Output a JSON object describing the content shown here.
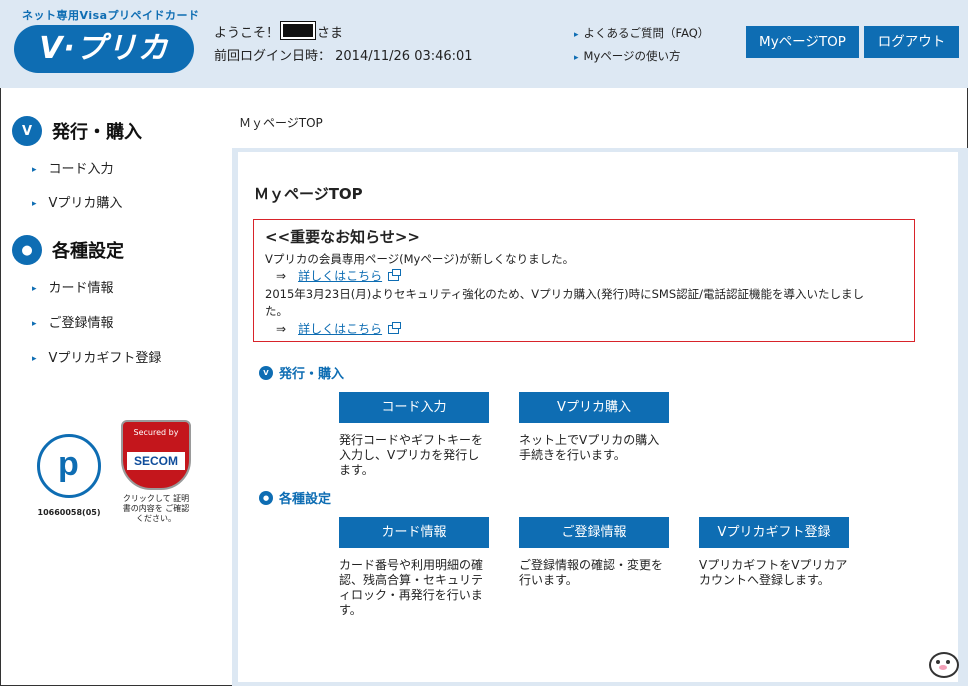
{
  "header": {
    "brand_tag": "ネット専用Visaプリペイドカード",
    "logo": "V·プリカ",
    "welcome_prefix": "ようこそ！",
    "welcome_suffix": "さま",
    "last_login": "前回ログイン日時： 2014/11/26 03:46:01",
    "links": [
      "よくあるご質問（FAQ）",
      "Myページの使い方"
    ],
    "mypage_button": "MyページTOP",
    "logout_button": "ログアウト"
  },
  "sidebar": {
    "section1_title": "発行・購入",
    "section1_items": [
      "コード入力",
      "Vプリカ購入"
    ],
    "section2_title": "各種設定",
    "section2_items": [
      "カード情報",
      "ご登録情報",
      "Vプリカギフト登録"
    ],
    "privacy_number": "10660058(05)",
    "secom_top": "Secured by",
    "secom_logo": "SECOM",
    "secom_caption": "クリックして 証明書の内容を ご確認ください。"
  },
  "breadcrumb": "ＭｙページTOP",
  "main": {
    "title": "ＭｙページTOP",
    "notice": {
      "title": "<<重要なお知らせ>>",
      "line1": "Vプリカの会員専用ページ(Myページ)が新しくなりました。",
      "more1": "詳しくはこちら",
      "line2": "2015年3月23日(月)よりセキュリティ強化のため、Vプリカ購入(発行)時にSMS認証/電話認証機能を導入いたしまし",
      "line2b": "た。",
      "more2": "詳しくはこちら",
      "arrow": "⇒"
    },
    "section1": {
      "title": "発行・購入",
      "buttons": [
        {
          "label": "コード入力",
          "desc": "発行コードやギフトキーを入力し、Vプリカを発行します。"
        },
        {
          "label": "Vプリカ購入",
          "desc": "ネット上でVプリカの購入手続きを行います。"
        }
      ]
    },
    "section2": {
      "title": "各種設定",
      "buttons": [
        {
          "label": "カード情報",
          "desc": "カード番号や利用明細の確認、残高合算・セキュリティロック・再発行を行います。"
        },
        {
          "label": "ご登録情報",
          "desc": "ご登録情報の確認・変更を行います。"
        },
        {
          "label": "Vプリカギフト登録",
          "desc": "VプリカギフトをVプリカアカウントへ登録します。"
        }
      ]
    }
  }
}
